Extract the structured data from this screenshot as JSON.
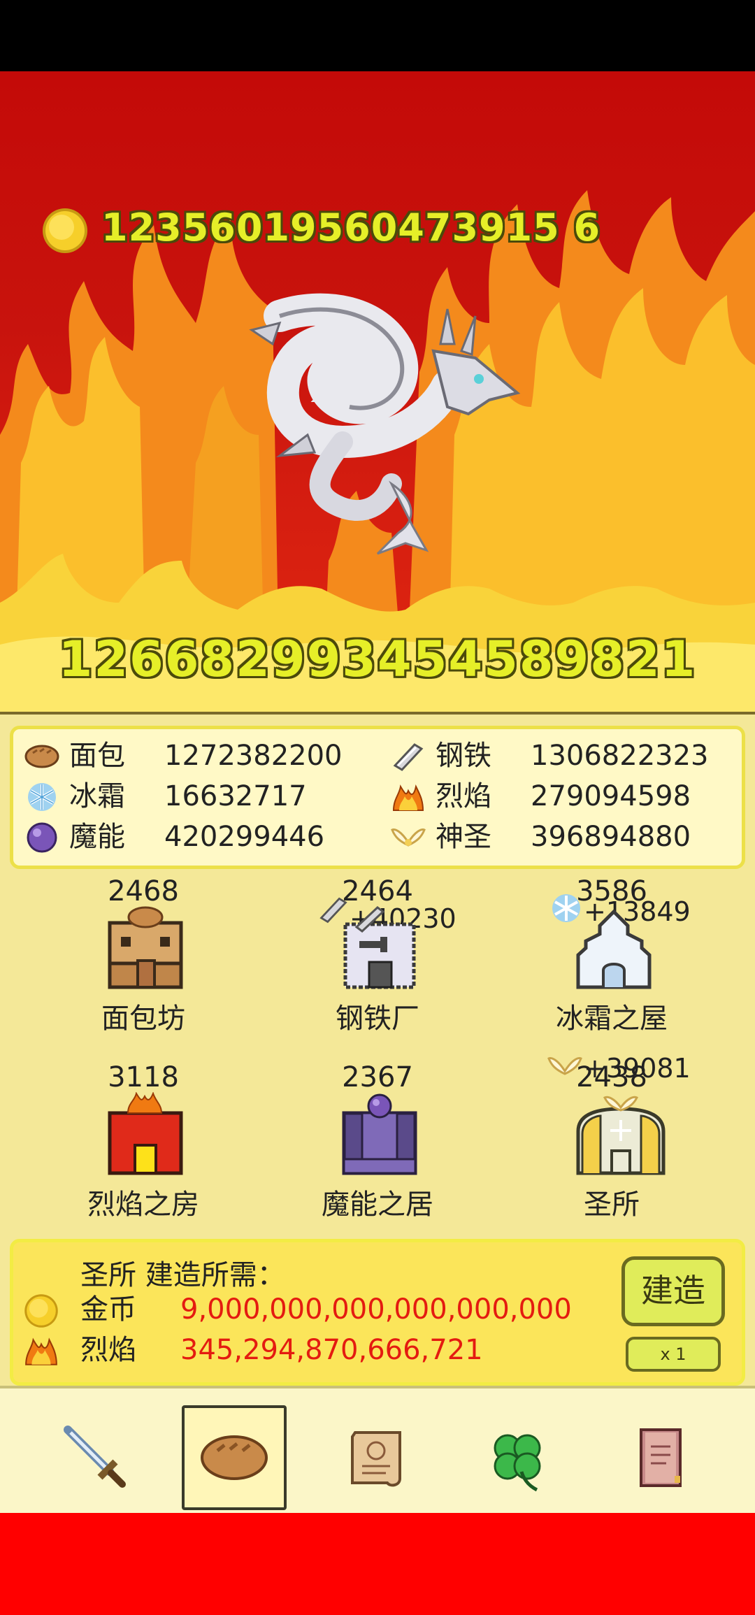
{
  "hud": {
    "coins": "12356019560473915 6",
    "dragon_hp": "126682993454589821"
  },
  "resources": [
    {
      "icon": "bread-icon",
      "name": "面包",
      "value": "1272382200"
    },
    {
      "icon": "steel-icon",
      "name": "钢铁",
      "value": "1306822323"
    },
    {
      "icon": "frost-icon",
      "name": "冰霜",
      "value": "16632717"
    },
    {
      "icon": "flame-icon",
      "name": "烈焰",
      "value": "279094598"
    },
    {
      "icon": "magic-orb-icon",
      "name": "魔能",
      "value": "420299446"
    },
    {
      "icon": "holy-wings-icon",
      "name": "神圣",
      "value": "396894880"
    }
  ],
  "buildings": [
    {
      "name": "面包坊",
      "count": "2468",
      "gain": ""
    },
    {
      "name": "钢铁厂",
      "count": "2464",
      "gain": "+40230"
    },
    {
      "name": "冰霜之屋",
      "count": "3586",
      "gain": "+13849"
    },
    {
      "name": "烈焰之房",
      "count": "3118",
      "gain": ""
    },
    {
      "name": "魔能之居",
      "count": "2367",
      "gain": ""
    },
    {
      "name": "圣所",
      "count": "2438",
      "gain": "+39081"
    }
  ],
  "build": {
    "title": "圣所 建造所需：",
    "requirements": [
      {
        "icon": "coin-icon",
        "name": "金币",
        "value": "9,000,000,000,000,000,000"
      },
      {
        "icon": "flame-icon",
        "name": "烈焰",
        "value": "345,294,870,666,721"
      }
    ],
    "button_label": "建造",
    "multiplier_label": "x 1"
  },
  "nav": {
    "tabs": [
      {
        "icon": "sword-icon",
        "active": false
      },
      {
        "icon": "bread-icon",
        "active": true
      },
      {
        "icon": "scroll-icon",
        "active": false
      },
      {
        "icon": "clover-icon",
        "active": false
      },
      {
        "icon": "book-icon",
        "active": false
      }
    ]
  },
  "colors": {
    "scene_red": "#c40a08",
    "number_yellow": "#e6ef28",
    "panel": "#f4e898",
    "cost_red": "#e41b10",
    "bottom_red": "#ff0000"
  }
}
